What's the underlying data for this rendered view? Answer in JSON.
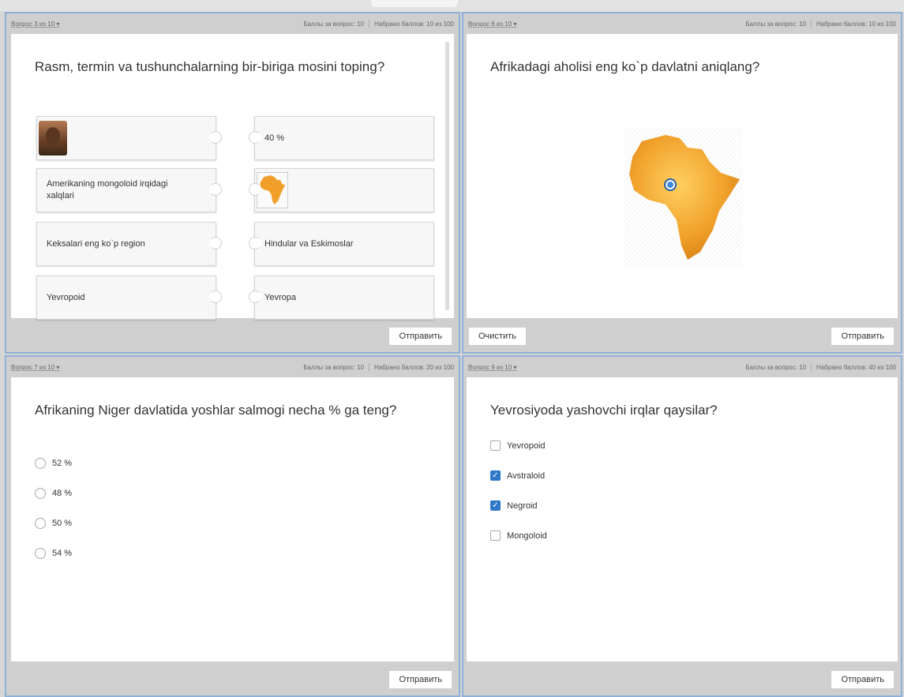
{
  "panels": {
    "p1": {
      "question_num": "Вопрос 3 из 10 ▾",
      "points": "Баллы за вопрос: 10",
      "scored": "Набрано баллов: 10 из 100",
      "question": "Rasm, termin va tushunchalarning bir-biriga mosini toping?",
      "left_items": [
        "",
        "Amerikaning mongoloid irqidagi xalqlari",
        "Keksalari eng ko`p region",
        "Yevropoid"
      ],
      "right_items": [
        "40 %",
        "",
        "Hindular va Eskimoslar",
        "Yevropa"
      ],
      "submit": "Отправить"
    },
    "p2": {
      "question_num": "Вопрос 6 из 10 ▾",
      "points": "Баллы за вопрос: 10",
      "scored": "Набрано баллов: 10 из 100",
      "question": "Afrikadagi aholisi eng ko`p davlatni aniqlang?",
      "clear": "Очистить",
      "submit": "Отправить"
    },
    "p3": {
      "question_num": "Вопрос 7 из 10 ▾",
      "points": "Баллы за вопрос: 10",
      "scored": "Набрано баллов: 20 из 100",
      "question": "Afrikaning Niger davlatida yoshlar salmogi necha % ga teng?",
      "options": [
        "52 %",
        "48 %",
        "50 %",
        "54 %"
      ],
      "submit": "Отправить"
    },
    "p4": {
      "question_num": "Вопрос 9 из 10 ▾",
      "points": "Баллы за вопрос: 10",
      "scored": "Набрано баллов: 40 из 100",
      "question": "Yevrosiyoda yashovchi irqlar qaysilar?",
      "options": [
        {
          "label": "Yevropoid",
          "checked": false
        },
        {
          "label": "Avstraloid",
          "checked": true
        },
        {
          "label": "Negroid",
          "checked": true
        },
        {
          "label": "Mongoloid",
          "checked": false
        }
      ],
      "submit": "Отправить"
    }
  },
  "colors": {
    "accent": "#2f78c8",
    "map_orange": "#f0a02a",
    "border": "#8fb1d8"
  }
}
